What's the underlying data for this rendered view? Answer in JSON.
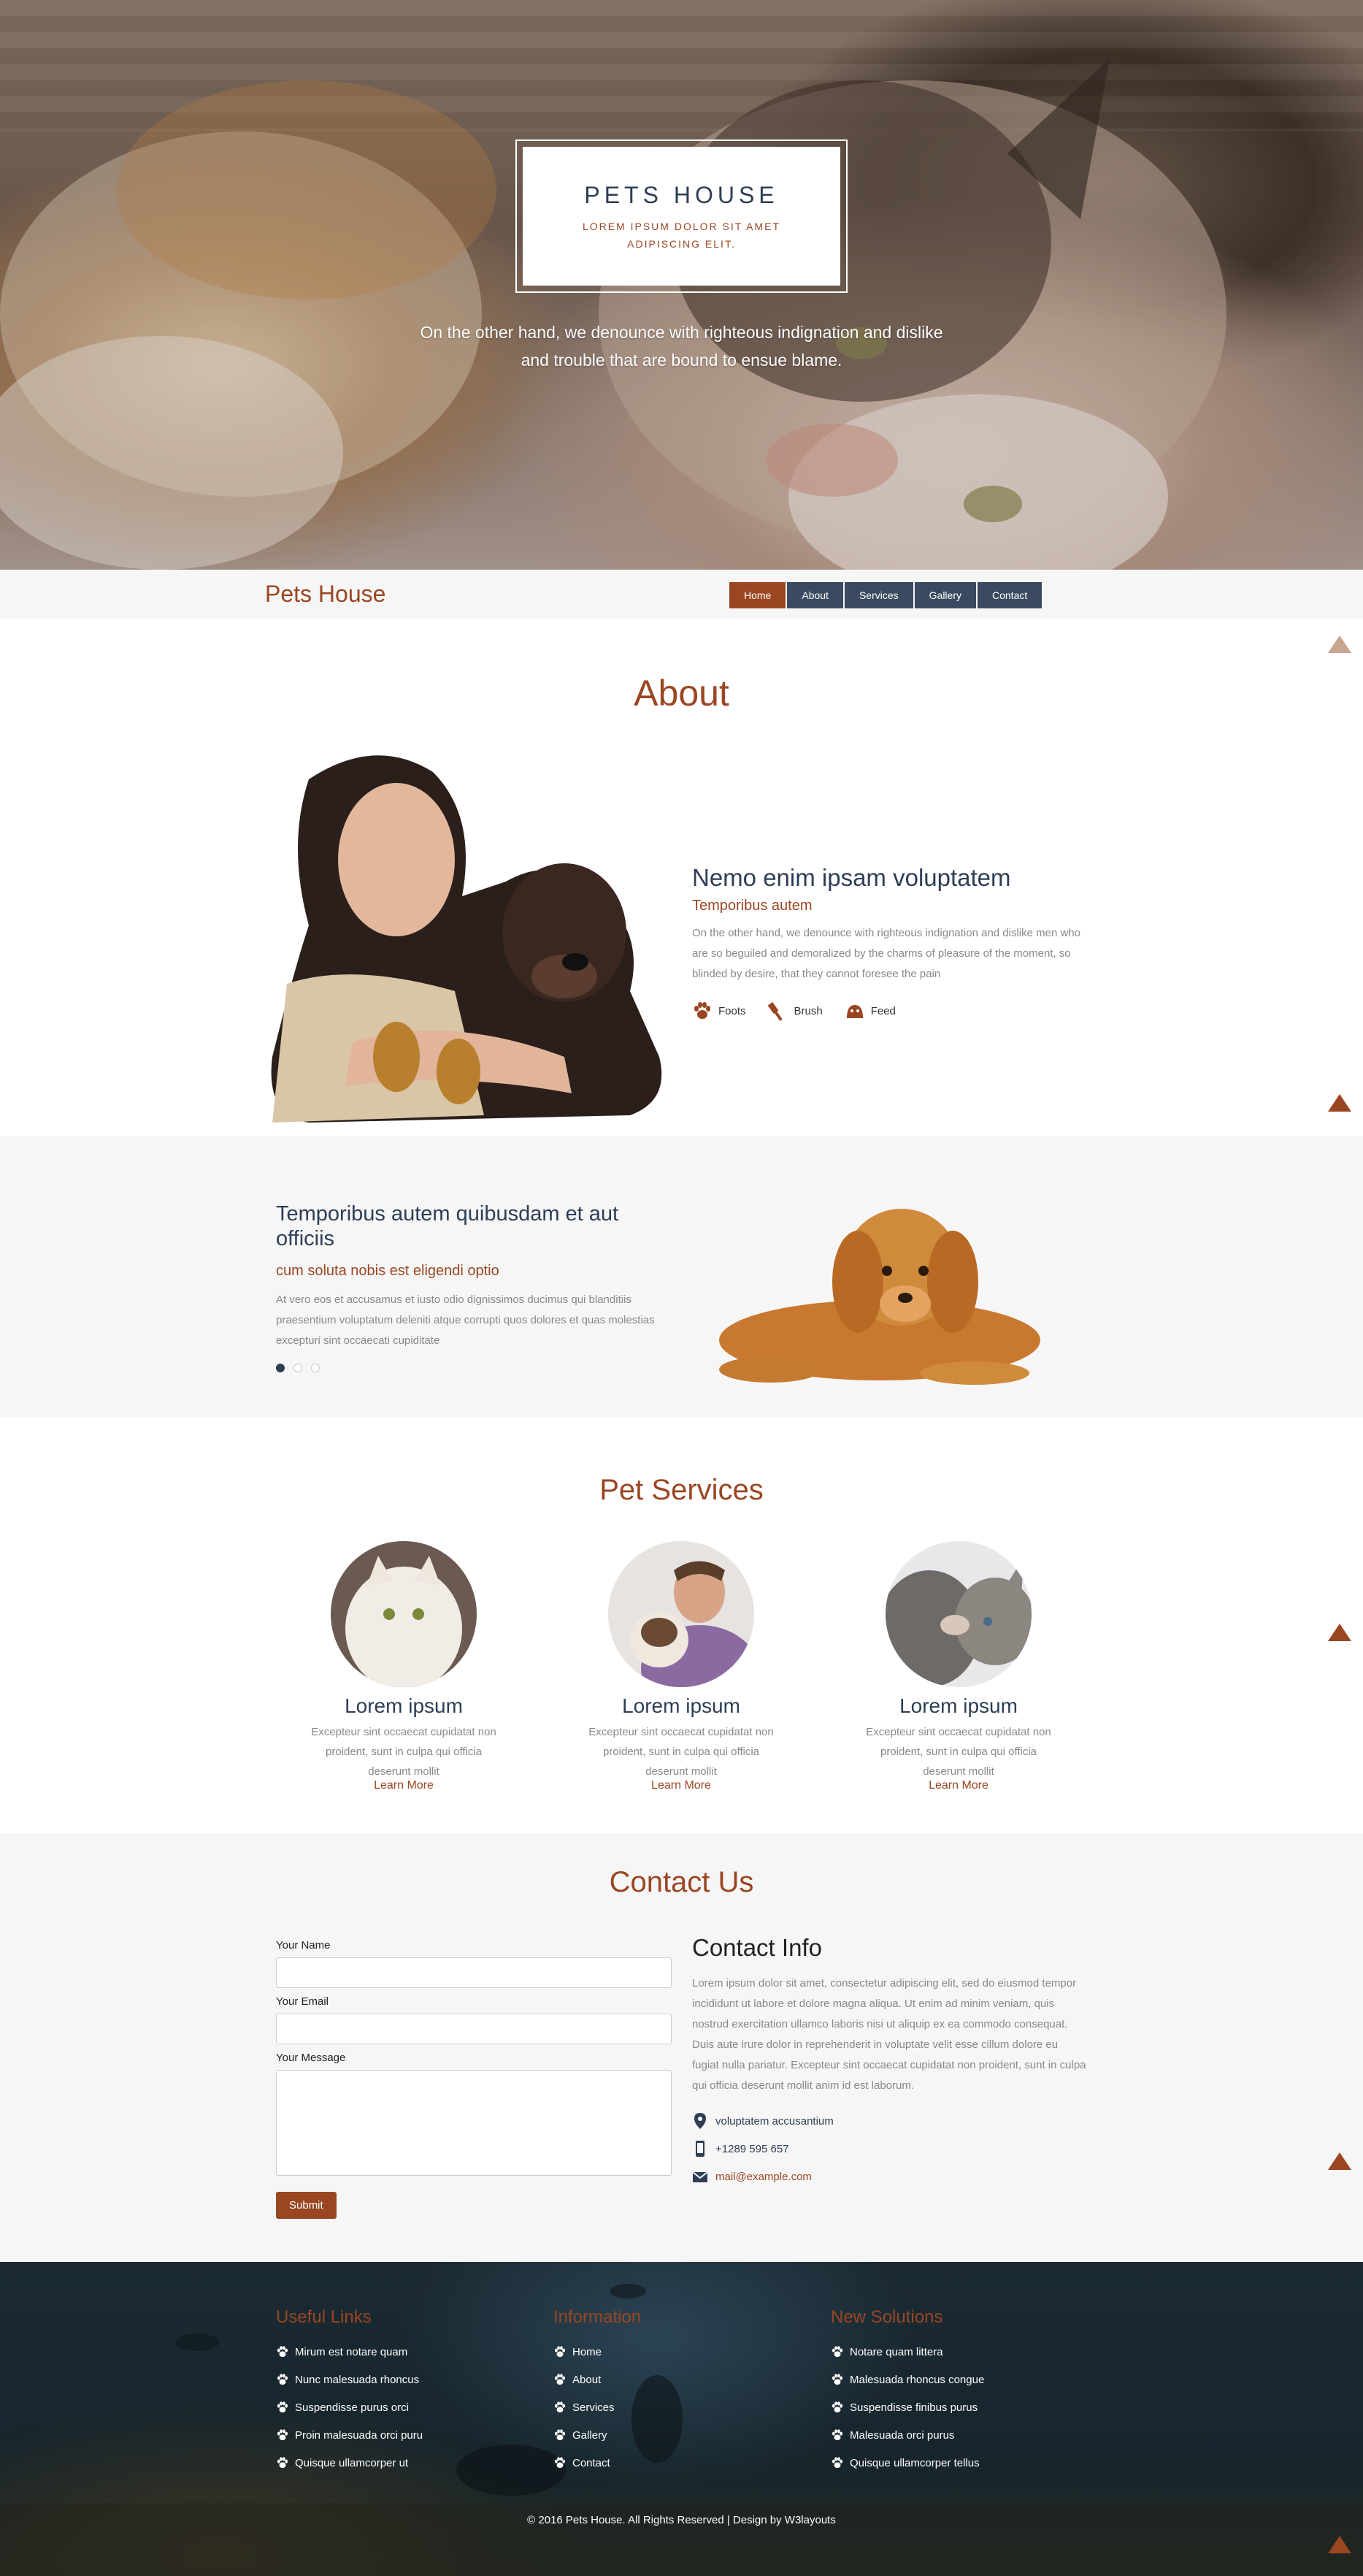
{
  "hero": {
    "logo_title": "PETS HOUSE",
    "logo_sub": "LOREM IPSUM DOLOR SIT AMET ADIPISCING ELIT.",
    "tagline": "On the other hand, we denounce with righteous indignation and dislike and trouble that are bound to ensue blame."
  },
  "nav": {
    "brand": "Pets House",
    "items": [
      "Home",
      "About",
      "Services",
      "Gallery",
      "Contact"
    ],
    "active": "Home"
  },
  "about": {
    "title": "About",
    "heading": "Nemo enim ipsam voluptatem",
    "subheading": "Temporibus autem",
    "text": "On the other hand, we denounce with righteous indignation and dislike men who are so beguiled and demoralized by the charms of pleasure of the moment, so blinded by desire, that they cannot foresee the pain",
    "features": [
      {
        "label": "Foots",
        "icon": "paw-icon"
      },
      {
        "label": "Brush",
        "icon": "brush-icon"
      },
      {
        "label": "Feed",
        "icon": "feed-icon"
      }
    ]
  },
  "slider": {
    "heading": "Temporibus autem quibusdam et aut officiis",
    "subheading": "cum soluta nobis est eligendi optio",
    "text": "At vero eos et accusamus et iusto odio dignissimos ducimus qui blanditiis praesentium voluptatum deleniti atque corrupti quos dolores et quas molestias excepturi sint occaecati cupiditate",
    "dots": 3,
    "active_dot": 1
  },
  "services": {
    "title": "Pet Services",
    "items": [
      {
        "title": "Lorem ipsum",
        "text": "Excepteur sint occaecat cupidatat non proident, sunt in culpa qui officia deserunt mollit",
        "link": "Learn More"
      },
      {
        "title": "Lorem ipsum",
        "text": "Excepteur sint occaecat cupidatat non proident, sunt in culpa qui officia deserunt mollit",
        "link": "Learn More"
      },
      {
        "title": "Lorem ipsum",
        "text": "Excepteur sint occaecat cupidatat non proident, sunt in culpa qui officia deserunt mollit",
        "link": "Learn More"
      }
    ]
  },
  "contact": {
    "title": "Contact Us",
    "form": {
      "name_label": "Your Name",
      "email_label": "Your Email",
      "message_label": "Your Message",
      "submit": "Submit"
    },
    "info": {
      "heading": "Contact Info",
      "text": "Lorem ipsum dolor sit amet, consectetur adipiscing elit, sed do eiusmod tempor incididunt ut labore et dolore magna aliqua. Ut enim ad minim veniam, quis nostrud exercitation ullamco laboris nisi ut aliquip ex ea commodo consequat. Duis aute irure dolor in reprehenderit in voluptate velit esse cillum dolore eu fugiat nulla pariatur. Excepteur sint occaecat cupidatat non proident, sunt in culpa qui officia deserunt mollit anim id est laborum.",
      "address": "voluptatem accusantium",
      "phone": "+1289 595 657",
      "email": "mail@example.com"
    }
  },
  "footer": {
    "columns": [
      {
        "heading": "Useful Links",
        "items": [
          "Mirum est notare quam",
          "Nunc malesuada rhoncus",
          "Suspendisse purus orci",
          "Proin malesuada orci puru",
          "Quisque ullamcorper ut"
        ]
      },
      {
        "heading": "Information",
        "items": [
          "Home",
          "About",
          "Services",
          "Gallery",
          "Contact"
        ]
      },
      {
        "heading": "New Solutions",
        "items": [
          "Notare quam littera",
          "Malesuada rhoncus congue",
          "Suspendisse finibus purus",
          "Malesuada orci purus",
          "Quisque ullamcorper tellus"
        ]
      }
    ],
    "copyright": "© 2016 Pets House. All Rights Reserved | Design by W3layouts"
  },
  "colors": {
    "accent": "#9a4622",
    "navy": "#2d3e55",
    "nav_button": "#3b4a60"
  }
}
